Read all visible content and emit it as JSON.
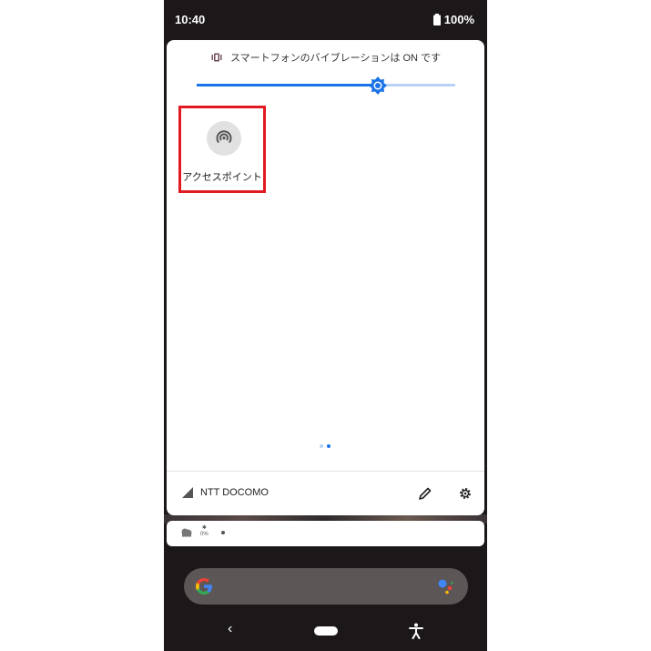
{
  "status_bar": {
    "time": "10:40",
    "battery": "100%"
  },
  "quick_settings": {
    "vibration_text": "スマートフォンのバイブレーションは ON です",
    "brightness_level": 0.7,
    "tile": {
      "label": "アクセスポイント",
      "icon": "hotspot-icon"
    },
    "page_dots": [
      "inactive",
      "active"
    ],
    "carrier": "NTT DOCOMO",
    "edit_icon": "pencil-icon",
    "settings_icon": "gear-icon"
  },
  "notification": {
    "weather_percent": "0%"
  },
  "colors": {
    "accent": "#1a73e8",
    "highlight_border": "#e11a22",
    "scrim": "#1c1718",
    "dot_inactive": "#b7d2f5"
  },
  "nav": {
    "back": "‹"
  }
}
